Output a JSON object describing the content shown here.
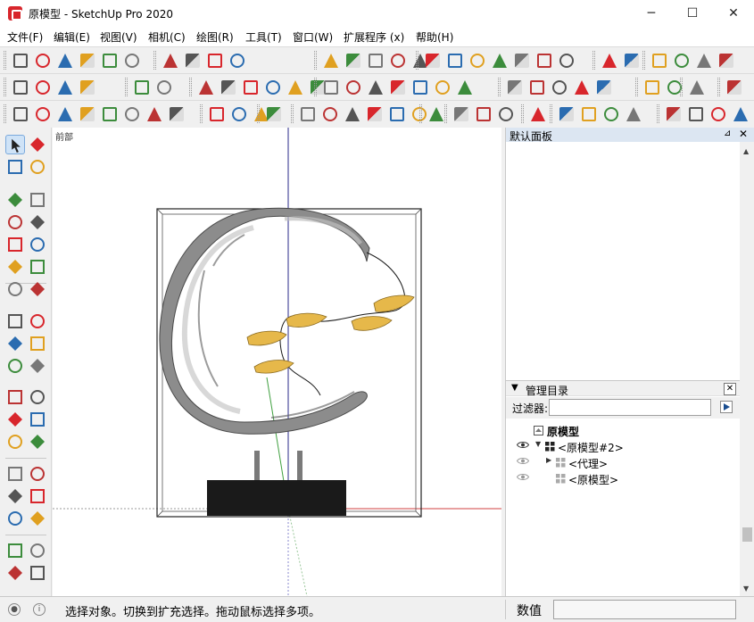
{
  "window": {
    "title": "原模型 - SketchUp Pro 2020",
    "minimize_glyph": "─",
    "maximize_glyph": "☐",
    "close_glyph": "✕"
  },
  "menu": [
    "文件(F)",
    "编辑(E)",
    "视图(V)",
    "相机(C)",
    "绘图(R)",
    "工具(T)",
    "窗口(W)",
    "扩展程序 (x)",
    "帮助(H)"
  ],
  "viewport": {
    "scene_label": "前部"
  },
  "tray": {
    "title": "默认面板",
    "pin_glyph": "⊿",
    "close_glyph": "✕"
  },
  "outliner": {
    "title": "管理目录",
    "collapse_glyph": "▼",
    "close_glyph": "✕",
    "filter_label": "过滤器:",
    "filter_value": "",
    "root_label": "原模型",
    "items": [
      {
        "label": "<原模型#2>",
        "expander": "▼",
        "visible_eye": "dark"
      },
      {
        "label": "<代理>",
        "expander": "▶",
        "visible_eye": "light"
      },
      {
        "label": "<原模型>",
        "expander": "",
        "visible_eye": "light"
      }
    ]
  },
  "status": {
    "message": "选择对象。切换到扩充选择。拖动鼠标选择多项。",
    "value_label": "数值",
    "value": ""
  },
  "colors": {
    "accent_red": "#d8262c",
    "leaf_yellow": "#e6b84a",
    "sculpture_gray": "#8c8c8c",
    "base_black": "#1a1a1a",
    "tray_header": "#dce6f2"
  }
}
